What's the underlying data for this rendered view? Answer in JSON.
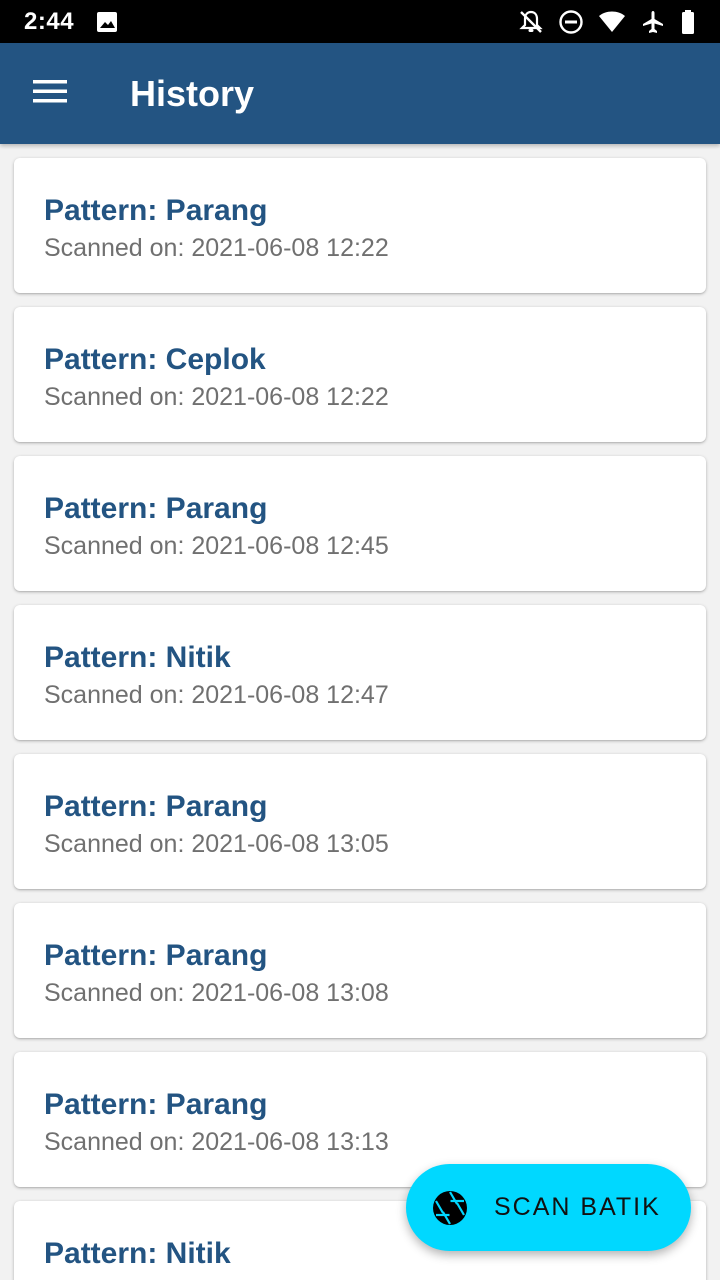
{
  "status_bar": {
    "time": "2:44",
    "icons": [
      "image-icon",
      "notifications-off-icon",
      "do-not-disturb-icon",
      "wifi-icon",
      "airplane-icon",
      "battery-icon"
    ]
  },
  "app_bar": {
    "title": "History",
    "background": "#235482"
  },
  "history": [
    {
      "title": "Pattern: Parang",
      "scanned": "Scanned on: 2021-06-08 12:22"
    },
    {
      "title": "Pattern: Ceplok",
      "scanned": "Scanned on: 2021-06-08 12:22"
    },
    {
      "title": "Pattern: Parang",
      "scanned": "Scanned on: 2021-06-08 12:45"
    },
    {
      "title": "Pattern: Nitik",
      "scanned": "Scanned on: 2021-06-08 12:47"
    },
    {
      "title": "Pattern: Parang",
      "scanned": "Scanned on: 2021-06-08 13:05"
    },
    {
      "title": "Pattern: Parang",
      "scanned": "Scanned on: 2021-06-08 13:08"
    },
    {
      "title": "Pattern: Parang",
      "scanned": "Scanned on: 2021-06-08 13:13"
    },
    {
      "title": "Pattern: Nitik",
      "scanned": ""
    }
  ],
  "fab": {
    "label": "SCAN BATIK",
    "icon": "camera-aperture-icon",
    "color": "#00d8ff"
  }
}
